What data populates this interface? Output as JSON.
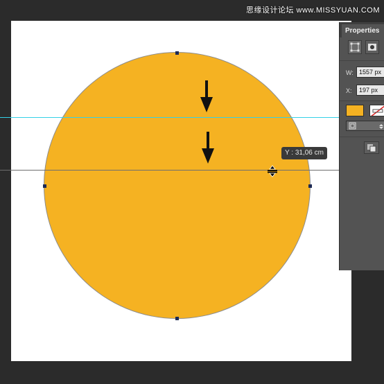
{
  "watermark": "思缘设计论坛 www.MISSYUAN.COM",
  "tooltip": {
    "y_readout": "Y : 31,06 cm"
  },
  "colors": {
    "shape_fill": "#f5b222",
    "guide_cyan": "#34d0e8",
    "guide_gray": "#6e6e6e",
    "canvas": "#ffffff",
    "workspace": "#2b2b2b",
    "panel": "#535353"
  },
  "properties_panel": {
    "title": "Properties",
    "fields": {
      "w_label": "W:",
      "w_value": "1557 px",
      "x_label": "X:",
      "x_value": "197 px"
    },
    "icons": {
      "mode_shape": "live-shape-properties-icon",
      "mode_mask": "mask-icon",
      "fill": "fill-swatch",
      "stroke": "stroke-swatch",
      "align": "stroke-align-icon",
      "path_ops": "path-operations-icon"
    }
  }
}
